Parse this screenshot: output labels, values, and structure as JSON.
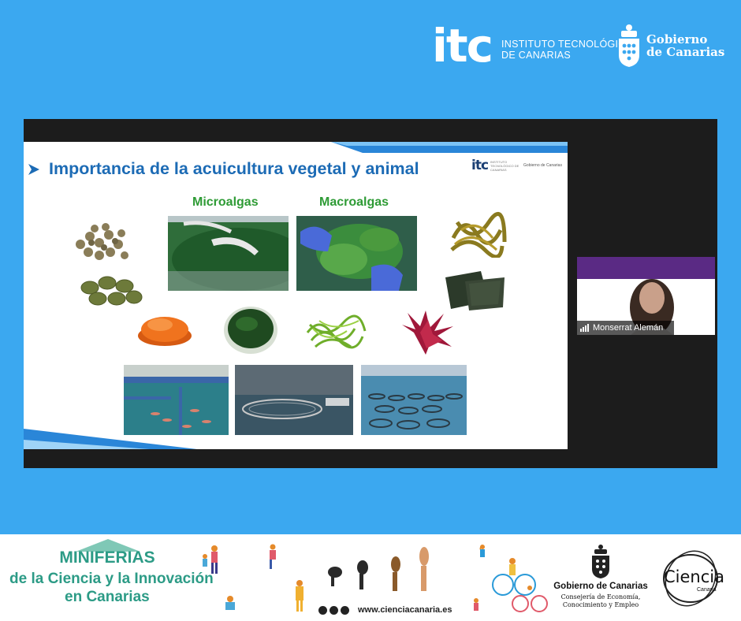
{
  "header": {
    "itc_mark": "itc",
    "itc_line1": "INSTITUTO TECNOLÓGIC",
    "itc_line2": "DE CANARIAS",
    "gob_line1": "Gobierno",
    "gob_line2": "de Canarias"
  },
  "slide": {
    "title": "Importancia de la acuicultura vegetal y animal",
    "label_micro": "Microalgas",
    "label_macro": "Macroalgas",
    "mini_itc": "itc",
    "mini_itc_text": "INSTITUTO TECNOLÓGICO DE CANARIAS",
    "mini_gob": "Gobierno de Canarias"
  },
  "participant": {
    "name": "Monserrat Alemán"
  },
  "footer": {
    "miniferias": "MINIFERIAS",
    "subtitle_line1": "de la Ciencia y la Innovación",
    "subtitle_line2": "en Canarias",
    "website": "www.cienciacanaria.es",
    "gob_title": "Gobierno de Canarias",
    "gob_dept_line1": "Consejería de Economía,",
    "gob_dept_line2": "Conocimiento y Empleo",
    "ciencia": "Ciencia",
    "ciencia_sub": "Canaria"
  },
  "colors": {
    "background": "#3ba8f0",
    "slide_title": "#1c6bb5",
    "label_green": "#2e9b35",
    "miniferias_teal": "#2c9b86"
  }
}
